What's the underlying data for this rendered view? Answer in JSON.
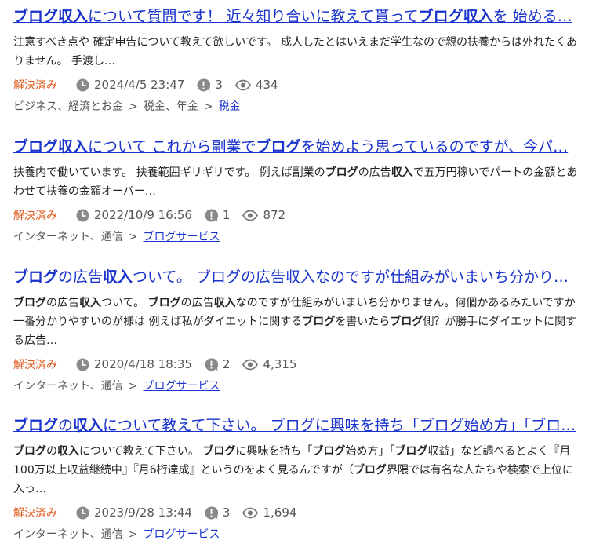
{
  "results": [
    {
      "title_parts": [
        {
          "t": "ブログ収入",
          "b": true
        },
        {
          "t": "について質問です！ 近々知り合いに教えて貰って",
          "b": false
        },
        {
          "t": "ブログ収入",
          "b": true
        },
        {
          "t": "を 始める…",
          "b": false
        }
      ],
      "snippet_parts": [
        {
          "t": "注意すべき点や 確定申告について教えて欲しいです。 成人したとはいえまだ学生なので親の扶養からは外れたくありません。 手渡し…",
          "b": false
        }
      ],
      "status": "解決済み",
      "date": "2024/4/5 23:47",
      "answers": "3",
      "views": "434",
      "categories": [
        {
          "label": "ビジネス、経済とお金",
          "link": false
        },
        {
          "label": "税金、年金",
          "link": false
        },
        {
          "label": "税金",
          "link": true
        }
      ]
    },
    {
      "title_parts": [
        {
          "t": "ブログ収入",
          "b": true
        },
        {
          "t": "について これから副業で",
          "b": false
        },
        {
          "t": "ブログ",
          "b": true
        },
        {
          "t": "を始めよう思っているのですが、今パ…",
          "b": false
        }
      ],
      "snippet_parts": [
        {
          "t": "扶養内で働いています。 扶養範囲ギリギリです。 例えば副業の",
          "b": false
        },
        {
          "t": "ブログ",
          "b": true
        },
        {
          "t": "の広告",
          "b": false
        },
        {
          "t": "収入",
          "b": true
        },
        {
          "t": "で五万円稼いでパートの金額とあわせて扶養の金額オーバー…",
          "b": false
        }
      ],
      "status": "解決済み",
      "date": "2022/10/9 16:56",
      "answers": "1",
      "views": "872",
      "categories": [
        {
          "label": "インターネット、通信",
          "link": false
        },
        {
          "label": "ブログサービス",
          "link": true
        }
      ]
    },
    {
      "title_parts": [
        {
          "t": "ブログ",
          "b": true
        },
        {
          "t": "の広告",
          "b": false
        },
        {
          "t": "収入",
          "b": true
        },
        {
          "t": "ついて。 ブログの広告収入なのですが仕組みがいまいち分かり…",
          "b": false
        }
      ],
      "snippet_parts": [
        {
          "t": "ブログ",
          "b": true
        },
        {
          "t": "の広告",
          "b": false
        },
        {
          "t": "収入",
          "b": true
        },
        {
          "t": "ついて。 ",
          "b": false
        },
        {
          "t": "ブログ",
          "b": true
        },
        {
          "t": "の広告",
          "b": false
        },
        {
          "t": "収入",
          "b": true
        },
        {
          "t": "なのですが仕組みがいまいち分かりません。何個かあるみたいですか一番分かりやすいのが様は 例えば私がダイエットに関する",
          "b": false
        },
        {
          "t": "ブログ",
          "b": true
        },
        {
          "t": "を書いたら",
          "b": false
        },
        {
          "t": "ブログ",
          "b": true
        },
        {
          "t": "側？が勝手にダイエットに関する広告…",
          "b": false
        }
      ],
      "status": "解決済み",
      "date": "2020/4/18 18:35",
      "answers": "2",
      "views": "4,315",
      "categories": [
        {
          "label": "インターネット、通信",
          "link": false
        },
        {
          "label": "ブログサービス",
          "link": true
        }
      ]
    },
    {
      "title_parts": [
        {
          "t": "ブログ",
          "b": true
        },
        {
          "t": "の",
          "b": false
        },
        {
          "t": "収入",
          "b": true
        },
        {
          "t": "について教えて下さい。 ブログに興味を持ち「ブログ始め方」「ブロ…",
          "b": false
        }
      ],
      "snippet_parts": [
        {
          "t": "ブログ",
          "b": true
        },
        {
          "t": "の",
          "b": false
        },
        {
          "t": "収入",
          "b": true
        },
        {
          "t": "について教えて下さい。 ",
          "b": false
        },
        {
          "t": "ブログ",
          "b": true
        },
        {
          "t": "に興味を持ち「",
          "b": false
        },
        {
          "t": "ブログ",
          "b": true
        },
        {
          "t": "始め方」「",
          "b": false
        },
        {
          "t": "ブログ",
          "b": true
        },
        {
          "t": "収益」など調べるとよく『月100万以上収益継続中』『月6桁達成』というのをよく見るんですが（",
          "b": false
        },
        {
          "t": "ブログ",
          "b": true
        },
        {
          "t": "界隈では有名な人たちや検索で上位に入っ…",
          "b": false
        }
      ],
      "status": "解決済み",
      "date": "2023/9/28 13:44",
      "answers": "3",
      "views": "1,694",
      "categories": [
        {
          "label": "インターネット、通信",
          "link": false
        },
        {
          "label": "ブログサービス",
          "link": true
        }
      ]
    }
  ]
}
